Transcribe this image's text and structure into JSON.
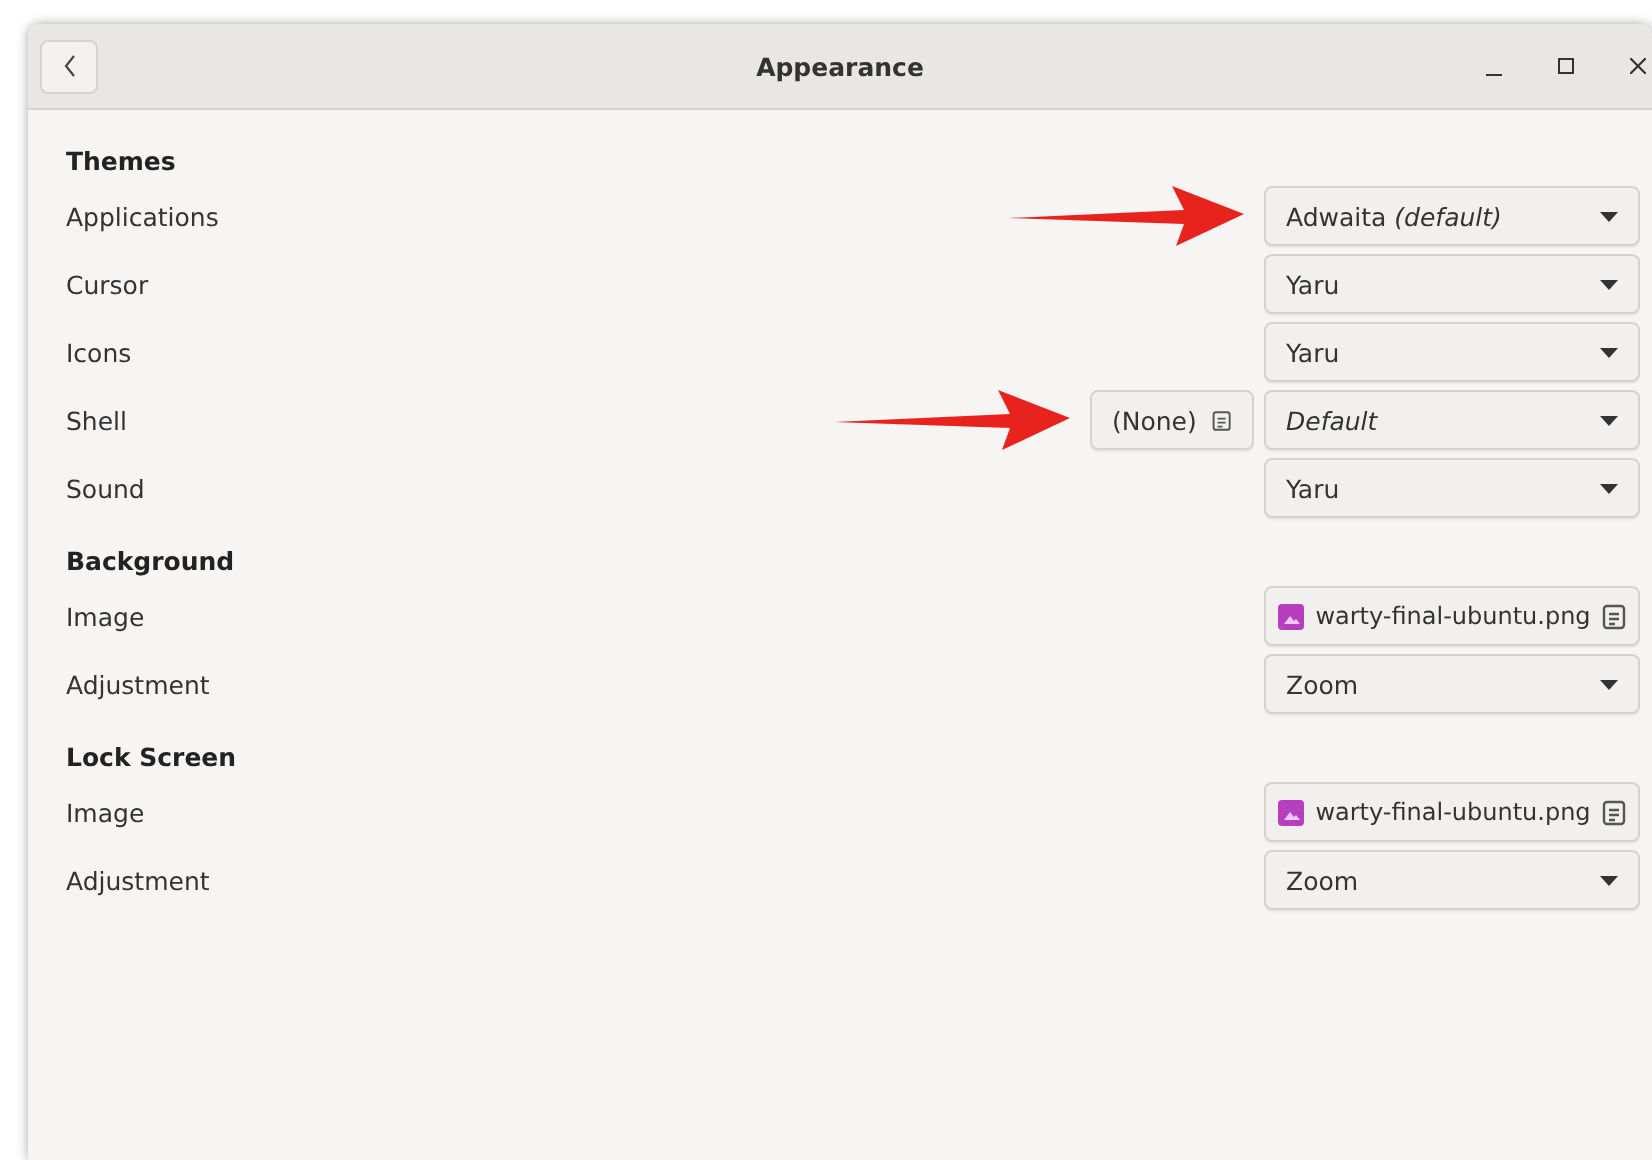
{
  "window": {
    "title": "Appearance"
  },
  "sections": [
    {
      "title": "Themes",
      "rows": [
        {
          "label": "Applications",
          "kind": "dropdown",
          "value": "Adwaita *(default)*",
          "italic": false,
          "annotated": true
        },
        {
          "label": "Cursor",
          "kind": "dropdown",
          "value": "Yaru",
          "italic": false,
          "annotated": false
        },
        {
          "label": "Icons",
          "kind": "dropdown",
          "value": "Yaru",
          "italic": false,
          "annotated": false
        },
        {
          "label": "Shell",
          "kind": "dropdown",
          "value": "Default",
          "italic": true,
          "annotated": true,
          "extra_button": "(None)"
        },
        {
          "label": "Sound",
          "kind": "dropdown",
          "value": "Yaru",
          "italic": false,
          "annotated": false
        }
      ]
    },
    {
      "title": "Background",
      "rows": [
        {
          "label": "Image",
          "kind": "file",
          "value": "warty-final-ubuntu.png",
          "italic": false,
          "annotated": false
        },
        {
          "label": "Adjustment",
          "kind": "dropdown",
          "value": "Zoom",
          "italic": false,
          "annotated": false
        }
      ]
    },
    {
      "title": "Lock Screen",
      "rows": [
        {
          "label": "Image",
          "kind": "file",
          "value": "warty-final-ubuntu.png",
          "italic": false,
          "annotated": false
        },
        {
          "label": "Adjustment",
          "kind": "dropdown",
          "value": "Zoom",
          "italic": false,
          "annotated": false
        }
      ]
    }
  ]
}
